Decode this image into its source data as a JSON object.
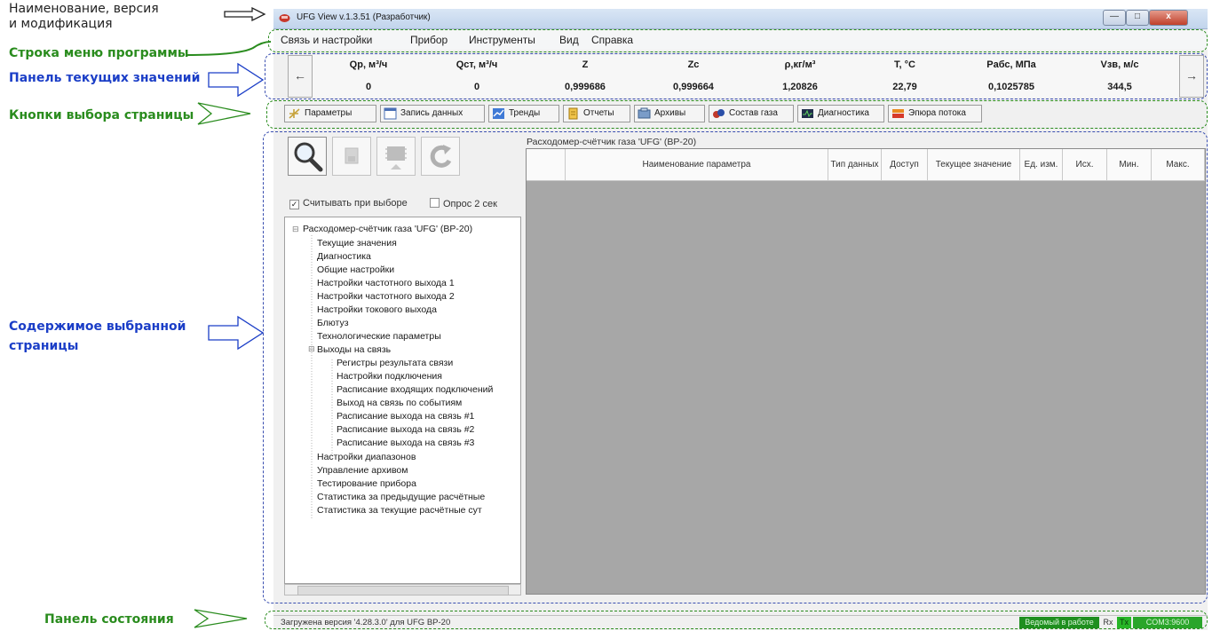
{
  "annotations": {
    "name_version": "Наименование, версия\nи модификация",
    "menu_row": "Строка меню программы",
    "values_panel": "Панель текущих значений",
    "page_buttons": "Кнопки выбора страницы",
    "page_content": "Содержимое выбранной\nстраницы",
    "status_panel": "Панель состояния"
  },
  "window": {
    "title": "UFG View v.1.3.51 (Разработчик)",
    "controls": [
      "—",
      "□",
      "x"
    ]
  },
  "menu": {
    "items": [
      "Связь и настройки",
      "Прибор",
      "Инструменты",
      "Вид",
      "Справка"
    ]
  },
  "values_panel": {
    "prev": "←",
    "next": "→",
    "columns": [
      {
        "label": "Qр, м³/ч",
        "value": "0"
      },
      {
        "label": "Qст, м³/ч",
        "value": "0"
      },
      {
        "label": "Z",
        "value": "0,999686"
      },
      {
        "label": "Zc",
        "value": "0,999664"
      },
      {
        "label": "ρ,кг/м³",
        "value": "1,20826"
      },
      {
        "label": "T, °C",
        "value": "22,79"
      },
      {
        "label": "Pабс, МПа",
        "value": "0,1025785"
      },
      {
        "label": "Vзв, м/с",
        "value": "344,5"
      }
    ]
  },
  "tabs": [
    {
      "label": "Параметры",
      "icon": "parameters-icon"
    },
    {
      "label": "Запись данных",
      "icon": "data-record-icon"
    },
    {
      "label": "Тренды",
      "icon": "trends-icon"
    },
    {
      "label": "Отчеты",
      "icon": "reports-icon"
    },
    {
      "label": "Архивы",
      "icon": "archives-icon"
    },
    {
      "label": "Состав газа",
      "icon": "gas-composition-icon"
    },
    {
      "label": "Диагностика",
      "icon": "diagnostics-icon"
    },
    {
      "label": "Эпюра потока",
      "icon": "flow-profile-icon"
    }
  ],
  "left_panel": {
    "checkbox_read": "Считывать при выборе",
    "checkbox_poll": "Опрос 2 сек",
    "tree": {
      "root": "Расходомер-счётчик газа 'UFG' (ВР-20)",
      "items": [
        "Текущие значения",
        "Диагностика",
        "Общие настройки",
        "Настройки частотного выхода 1",
        "Настройки частотного выхода 2",
        "Настройки токового выхода",
        "Блютуз",
        "Технологические параметры",
        "Выходы на связь"
      ],
      "subitems": [
        "Регистры результата связи",
        "Настройки подключения",
        "Расписание входящих подключений",
        "Выход на связь по событиям",
        "Расписание выхода на связь #1",
        "Расписание выхода на связь #2",
        "Расписание выхода на связь #3"
      ],
      "items_after": [
        "Настройки диапазонов",
        "Управление архивом",
        "Тестирование прибора",
        "Статистика за предыдущие расчётные",
        "Статистика за текущие расчётные сут"
      ]
    }
  },
  "grid": {
    "title": "Расходомер-счётчик газа 'UFG' (ВР-20)",
    "headers": [
      "",
      "Наименование параметра",
      "Тип данных",
      "Доступ",
      "Текущее значение",
      "Ед. изм.",
      "Исх.",
      "Мин.",
      "Макс."
    ]
  },
  "status": {
    "text": "Загружена версия '4.28.3.0' для UFG ВР-20",
    "state": "Ведомый в работе",
    "rx": "Rx",
    "tx": "Tx",
    "port": "COM3:9600"
  },
  "colors": {
    "annotation_green": "#2a8c1e",
    "annotation_blue": "#1b3ec7",
    "status_green": "#1f8f1f"
  }
}
